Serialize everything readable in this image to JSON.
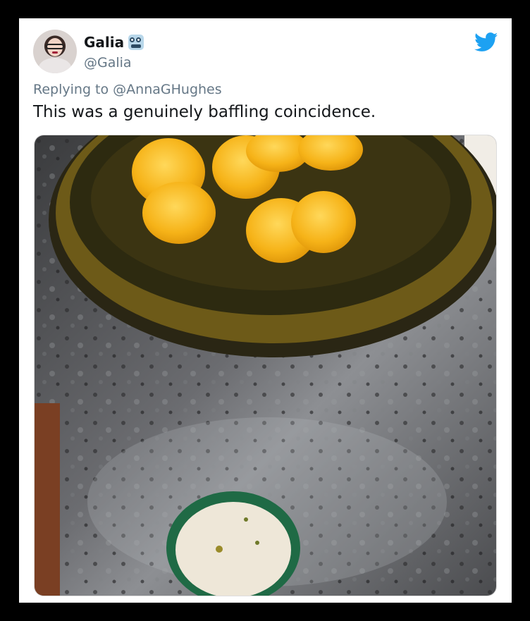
{
  "tweet": {
    "display_name": "Galia",
    "handle": "@Galia",
    "reply_prefix": "Replying to",
    "reply_to": "@AnnaGHughes",
    "text": "This was a genuinely baffling coincidence."
  },
  "icons": {
    "name_emoji": "robot-face-icon",
    "brand": "twitter-bird-icon"
  },
  "colors": {
    "twitter_blue": "#1da1f2",
    "secondary_text": "#657786",
    "primary_text": "#14171a"
  }
}
